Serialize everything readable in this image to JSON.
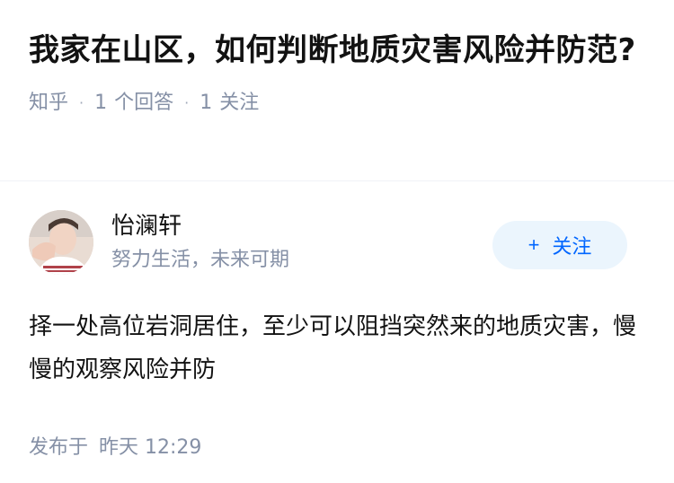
{
  "question": {
    "title": "我家在山区，如何判断地质灾害风险并防范?",
    "source": "知乎",
    "answer_count": "1",
    "answer_label": "个回答",
    "follow_count": "1",
    "follow_label": "关注"
  },
  "answer": {
    "author": {
      "name": "怡澜轩",
      "bio": "努力生活，未来可期",
      "avatar_icon": "avatar-photo"
    },
    "follow_button": {
      "icon": "+",
      "label": "关注",
      "color": "#0066ff",
      "background": "#ebf5fd"
    },
    "content": "择一处高位岩洞居住，至少可以阻挡突然来的地质灾害，慢慢的观察风险并防",
    "posted_label": "发布于",
    "posted_time": "昨天 12:29"
  }
}
